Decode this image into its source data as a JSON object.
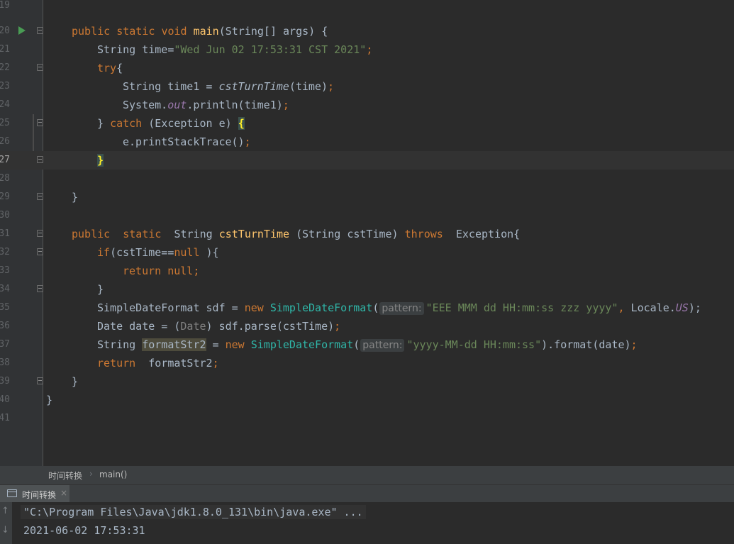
{
  "editor": {
    "lines": [
      {
        "num": "19"
      },
      {
        "num": "20"
      },
      {
        "num": "21"
      },
      {
        "num": "22"
      },
      {
        "num": "23"
      },
      {
        "num": "24"
      },
      {
        "num": "25"
      },
      {
        "num": "26"
      },
      {
        "num": "27"
      },
      {
        "num": "28"
      },
      {
        "num": "29"
      },
      {
        "num": "30"
      },
      {
        "num": "31"
      },
      {
        "num": "32"
      },
      {
        "num": "33"
      },
      {
        "num": "34"
      },
      {
        "num": "35"
      },
      {
        "num": "36"
      },
      {
        "num": "37"
      },
      {
        "num": "38"
      },
      {
        "num": "39"
      },
      {
        "num": "40"
      },
      {
        "num": "41"
      }
    ],
    "tokens": {
      "public": "public",
      "static": "static",
      "void": "void",
      "main": "main",
      "main_params": "(String[] args) {",
      "string_time_decl": "String time=",
      "time_literal": "\"Wed Jun 02 17:53:31 CST 2021\"",
      "semicolon": ";",
      "try": "try",
      "open_brace": "{",
      "string_time1": "String time1 = ",
      "cstTurnTime_call": "cstTurnTime",
      "time_arg": "(time)",
      "system": "System.",
      "out": "out",
      "println": ".println(time1)",
      "close_brace_space": "} ",
      "catch": "catch",
      "catch_params": " (Exception e) ",
      "print_stack": "e.printStackTrace()",
      "close_brace": "}",
      "string_type": "String",
      "cstTurnTime": "cstTurnTime",
      "cst_params": " (String cstTime) ",
      "throws": "throws",
      "exception_open": "  Exception{",
      "if": "if",
      "if_cond": "(cstTime==",
      "null": "null",
      "if_close": " ){",
      "return": "return",
      "null_semi": " null;",
      "sdf_decl": "SimpleDateFormat sdf = ",
      "new": "new",
      "SimpleDateFormat": "SimpleDateFormat",
      "paren_open": "(",
      "hint_pattern": "pattern:",
      "pattern1": "\"EEE MMM dd HH:mm:ss zzz yyyy\"",
      "comma": ",",
      "locale": " Locale.",
      "US": "US",
      "paren_semi": ");",
      "date_decl": "Date date = (",
      "Date": "Date",
      "parse": ") sdf.parse(cstTime)",
      "string_sp": "String ",
      "formatStr2": "formatStr2",
      "assign": " = ",
      "pattern2": "\"yyyy-MM-dd HH:mm:ss\"",
      "format_call": ").format(date)",
      "return_formatStr2": "  formatStr2"
    }
  },
  "breadcrumb": {
    "class_name": "时间转换",
    "method_name": "main()",
    "separator": "›"
  },
  "run_panel": {
    "tab_label": "时间转换",
    "tab_close": "×",
    "arrow_up": "↑",
    "arrow_down": "↓",
    "command": "\"C:\\Program Files\\Java\\jdk1.8.0_131\\bin\\java.exe\" ...",
    "output": "2021-06-02 17:53:31"
  },
  "colors": {
    "editor_bg": "#2b2b2b",
    "keyword": "#cc7832",
    "function": "#ffc66d",
    "string": "#6a8759",
    "static_field": "#9876aa",
    "class_ref": "#2fb6a8",
    "text": "#a9b7c6",
    "run_icon": "#499c54"
  }
}
